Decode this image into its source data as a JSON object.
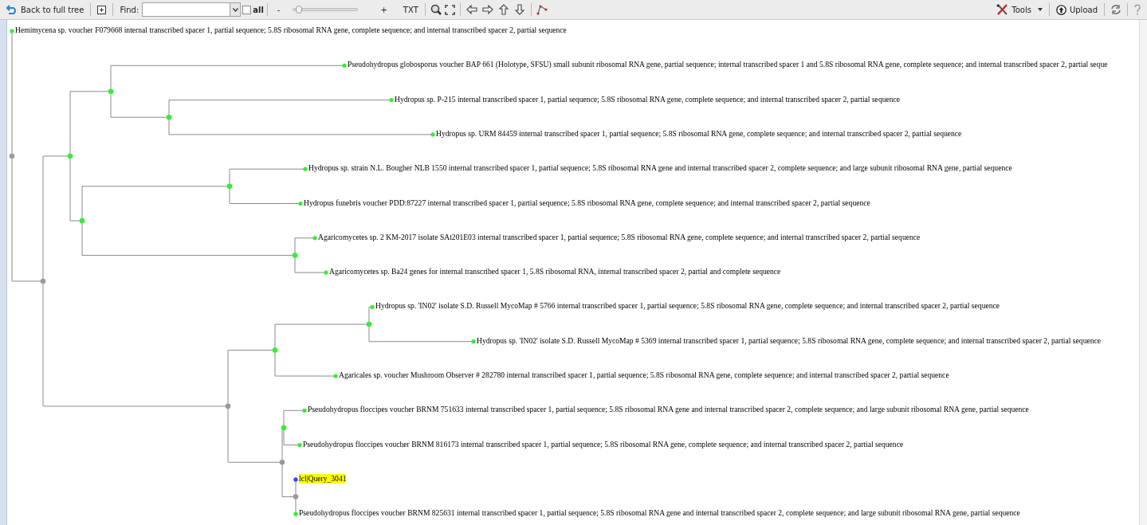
{
  "toolbar": {
    "back_button": "Back to full tree",
    "find_label": "Find:",
    "all_checkbox": {
      "label": "all",
      "checked": false
    },
    "zoom": {
      "minus": "-",
      "plus": "+",
      "level": 0.05
    },
    "txt_button": "TXT",
    "tools_button": "Tools",
    "upload_button": "Upload"
  },
  "tree": {
    "color": "#9a9a9a",
    "children": [
      {
        "label": "Hemimycena sp. voucher F079668 internal transcribed spacer 1, partial sequence; 5.8S ribosomal RNA gene, complete sequence; and internal transcribed spacer 2, partial sequence",
        "color": "#33ee33",
        "highlighted": false
      },
      {
        "color": "#9a9a9a",
        "children": [
          {
            "color": "#33ee33",
            "children": [
              {
                "color": "#33ee33",
                "children": [
                  {
                    "label": "Pseudohydropus globosporus voucher BAP 661 (Holotype, SFSU) small subunit ribosomal RNA gene, partial sequence; internal transcribed spacer 1 and 5.8S ribosomal RNA gene, complete sequence; and internal transcribed spacer 2, partial seque",
                    "color": "#33ee33",
                    "highlighted": false
                  },
                  {
                    "color": "#33ee33",
                    "children": [
                      {
                        "label": "Hydropus sp. P-215 internal transcribed spacer 1, partial sequence; 5.8S ribosomal RNA gene, complete sequence; and internal transcribed spacer 2, partial sequence",
                        "color": "#33ee33",
                        "highlighted": false
                      },
                      {
                        "label": "Hydropus sp. URM 84459 internal transcribed spacer 1, partial sequence; 5.8S ribosomal RNA gene, complete sequence; and internal transcribed spacer 2, partial sequence",
                        "color": "#33ee33",
                        "highlighted": false
                      }
                    ]
                  }
                ]
              },
              {
                "color": "#33ee33",
                "children": [
                  {
                    "color": "#33ee33",
                    "children": [
                      {
                        "label": "Hydropus sp. strain N.L. Bougher NLB 1550 internal transcribed spacer 1, partial sequence; 5.8S ribosomal RNA gene and internal transcribed spacer 2, complete sequence; and large subunit ribosomal RNA gene, partial sequence",
                        "color": "#33ee33",
                        "highlighted": false
                      },
                      {
                        "label": "Hydropus funebris voucher PDD:87227 internal transcribed spacer 1, partial sequence; 5.8S ribosomal RNA gene, complete sequence; and internal transcribed spacer 2, partial sequence",
                        "color": "#33ee33",
                        "highlighted": false
                      }
                    ]
                  },
                  {
                    "color": "#33ee33",
                    "children": [
                      {
                        "label": "Agaricomycetes sp. 2 KM-2017 isolate SAt201E03 internal transcribed spacer 1, partial sequence; 5.8S ribosomal RNA gene, complete sequence; and internal transcribed spacer 2, partial sequence",
                        "color": "#33ee33",
                        "highlighted": false
                      },
                      {
                        "label": "Agaricomycetes sp. Ba24 genes for internal transcribed spacer 1, 5.8S ribosomal RNA, internal transcribed spacer 2, partial and complete sequence",
                        "color": "#33ee33",
                        "highlighted": false
                      }
                    ]
                  }
                ]
              }
            ]
          },
          {
            "color": "#9a9a9a",
            "children": [
              {
                "color": "#33ee33",
                "children": [
                  {
                    "color": "#33ee33",
                    "children": [
                      {
                        "label": "Hydropus sp. 'IN02' isolate S.D. Russell MycoMap # 5766 internal transcribed spacer 1, partial sequence; 5.8S ribosomal RNA gene, complete sequence; and internal transcribed spacer 2, partial sequence",
                        "color": "#33ee33",
                        "highlighted": false
                      },
                      {
                        "label": "Hydropus sp. 'IN02' isolate S.D. Russell MycoMap # 5369 internal transcribed spacer 1, partial sequence; 5.8S ribosomal RNA gene, complete sequence; and internal transcribed spacer 2, partial sequence",
                        "color": "#33ee33",
                        "highlighted": false
                      }
                    ]
                  },
                  {
                    "label": "Agaricales sp. voucher Mushroom Observer # 282780 internal transcribed spacer 1, partial sequence; 5.8S ribosomal RNA gene, complete sequence; and internal transcribed spacer 2, partial sequence",
                    "color": "#33ee33",
                    "highlighted": false
                  }
                ]
              },
              {
                "color": "#9a9a9a",
                "children": [
                  {
                    "color": "#33ee33",
                    "children": [
                      {
                        "label": "Pseudohydropus floccipes voucher BRNM 751633 internal transcribed spacer 1, partial sequence; 5.8S ribosomal RNA gene and internal transcribed spacer 2, complete sequence; and large subunit ribosomal RNA gene, partial sequence",
                        "color": "#33ee33",
                        "highlighted": false
                      },
                      {
                        "label": "Pseudohydropus floccipes voucher BRNM 816173 internal transcribed spacer 1, partial sequence; 5.8S ribosomal RNA gene, complete sequence; and internal transcribed spacer 2, partial sequence",
                        "color": "#33ee33",
                        "highlighted": false
                      }
                    ]
                  },
                  {
                    "color": "#9a9a9a",
                    "children": [
                      {
                        "label": "lcl|Query_3041",
                        "color": "#3344ee",
                        "highlighted": true
                      },
                      {
                        "label": "Pseudohydropus floccipes voucher BRNM 825631 internal transcribed spacer 1, partial sequence; 5.8S ribosomal RNA gene and internal transcribed spacer 2, complete sequence; and large subunit ribosomal RNA gene, partial sequence",
                        "color": "#33ee33",
                        "highlighted": false
                      }
                    ]
                  }
                ]
              }
            ]
          }
        ]
      }
    ]
  }
}
